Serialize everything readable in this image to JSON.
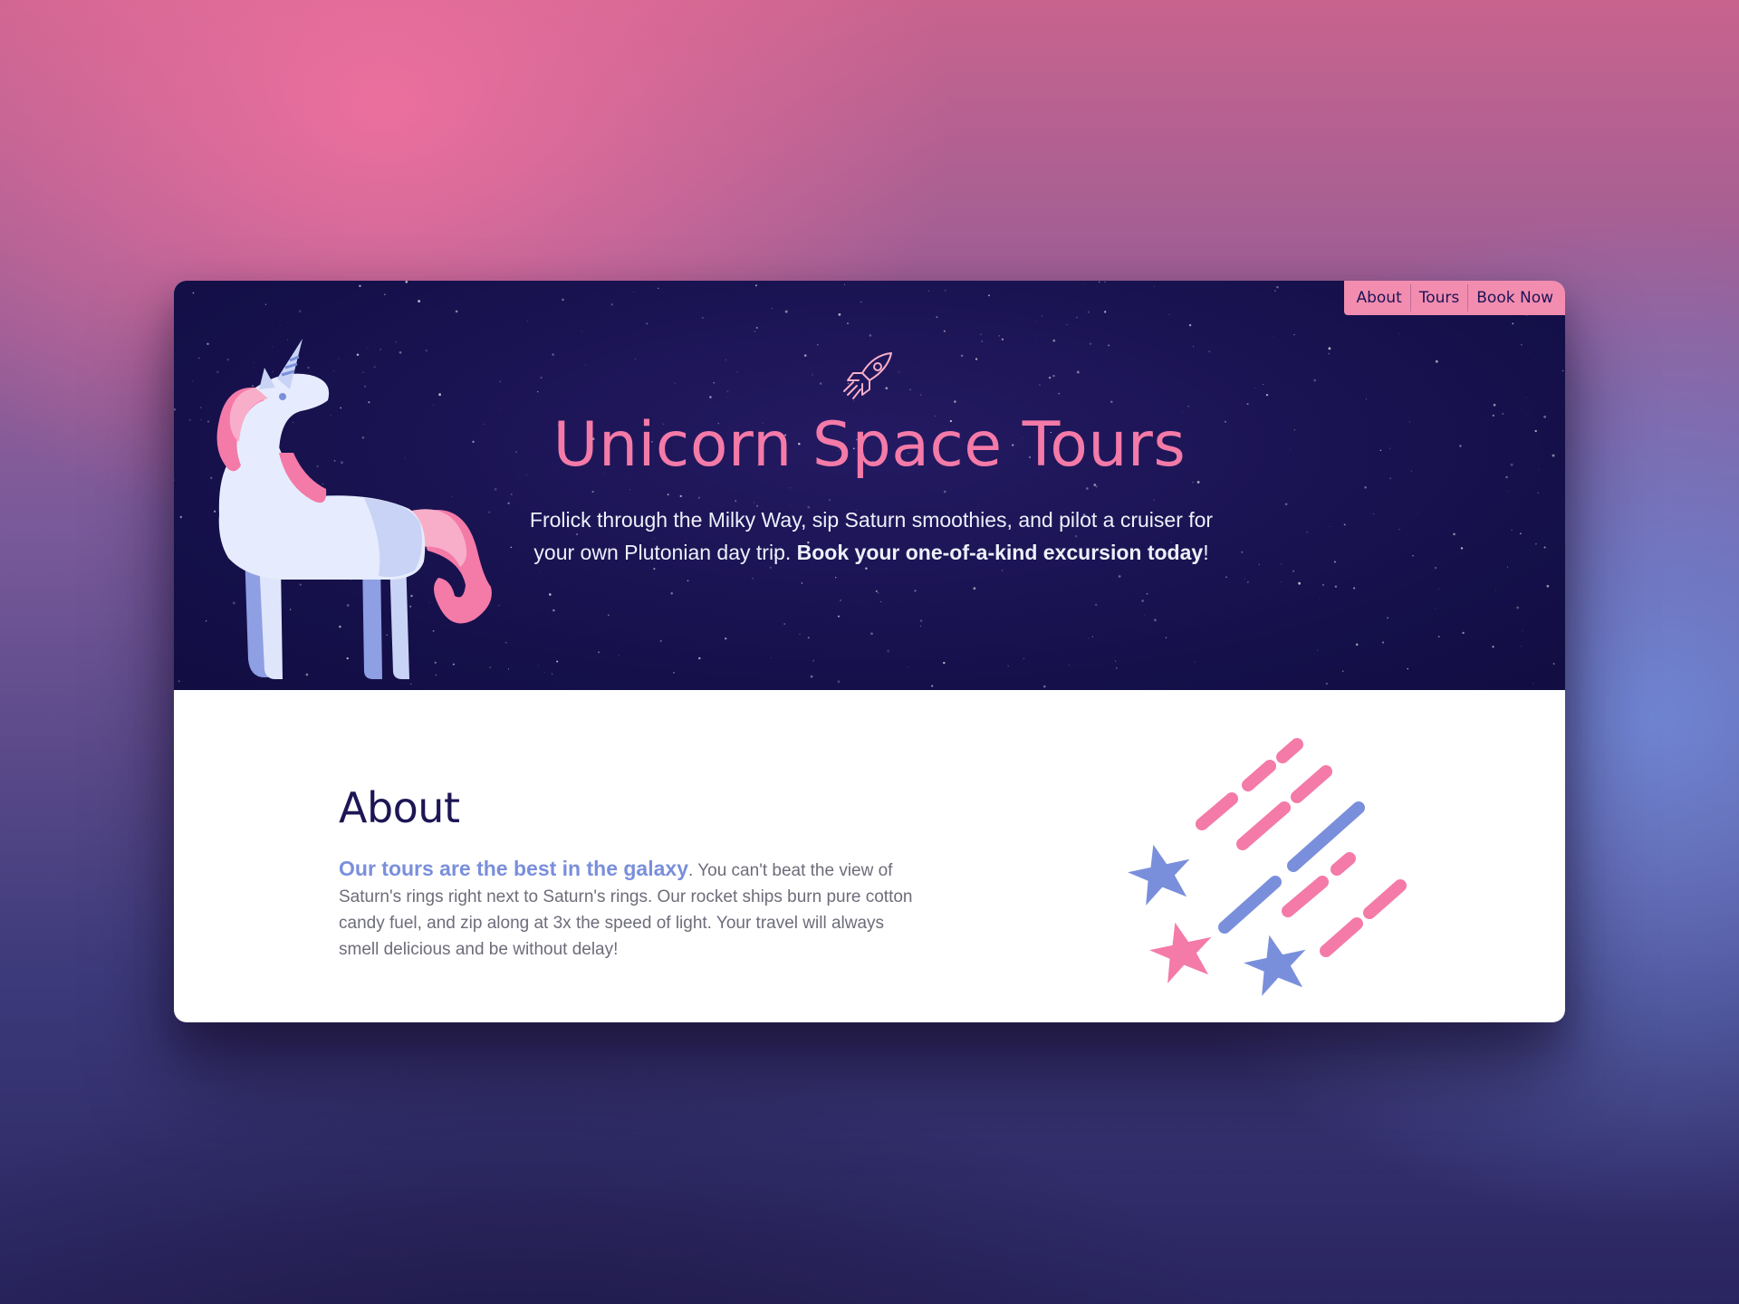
{
  "nav": {
    "items": [
      {
        "label": "About"
      },
      {
        "label": "Tours"
      },
      {
        "label": "Book Now"
      }
    ]
  },
  "hero": {
    "title": "Unicorn Space Tours",
    "subtitle_intro": "Frolick through the Milky Way, sip Saturn smoothies, and pilot a cruiser for your own Plutonian day trip. ",
    "subtitle_cta": "Book your one-of-a-kind excursion today",
    "subtitle_end": "!",
    "rocket_icon": "rocket-icon",
    "illustration": "unicorn-illustration"
  },
  "about": {
    "heading": "About",
    "lead": "Our tours are the best in the galaxy",
    "body": ". You can't beat the view of Saturn's rings right next to Saturn's rings. Our rocket ships burn pure cotton candy fuel, and zip along at 3x the speed of light. Your travel will always smell delicious and be without delay!",
    "illustration": "shooting-stars-illustration"
  },
  "colors": {
    "pink": "#f47aa8",
    "navy": "#15104a",
    "periwinkle": "#7a8fdb"
  }
}
